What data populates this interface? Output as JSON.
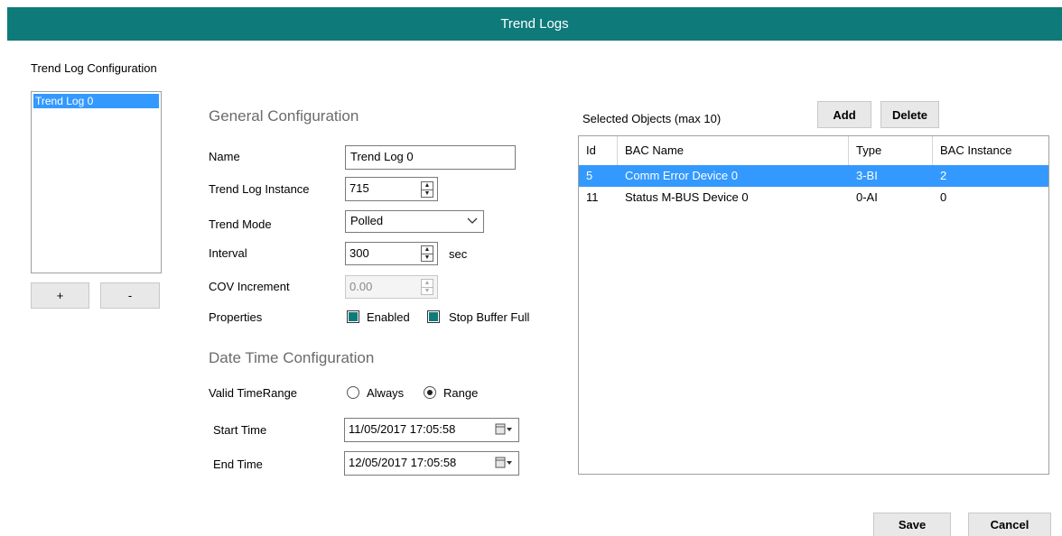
{
  "window": {
    "title": "Trend Logs"
  },
  "trend_log_configuration": {
    "title": "Trend Log Configuration",
    "items": [
      "Trend Log 0"
    ],
    "add_label": "+",
    "remove_label": "-"
  },
  "general": {
    "title": "General Configuration",
    "name_label": "Name",
    "name_value": "Trend Log 0",
    "instance_label": "Trend Log Instance",
    "instance_value": "715",
    "mode_label": "Trend Mode",
    "mode_value": "Polled",
    "interval_label": "Interval",
    "interval_value": "300",
    "interval_unit": "sec",
    "cov_label": "COV Increment",
    "cov_value": "0.00",
    "properties_label": "Properties",
    "enabled_label": "Enabled",
    "enabled_checked": true,
    "stop_buffer_label": "Stop Buffer Full",
    "stop_buffer_checked": true
  },
  "datetime": {
    "title": "Date Time Configuration",
    "valid_label": "Valid TimeRange",
    "always_label": "Always",
    "range_label": "Range",
    "selected": "Range",
    "start_label": "Start Time",
    "start_value": "11/05/2017 17:05:58",
    "end_label": "End Time",
    "end_value": "12/05/2017 17:05:58"
  },
  "selected_objects": {
    "title": "Selected Objects (max 10)",
    "add_label": "Add",
    "delete_label": "Delete",
    "columns": [
      "Id",
      "BAC Name",
      "Type",
      "BAC Instance"
    ],
    "rows": [
      {
        "id": "5",
        "name": "Comm Error Device 0",
        "type": "3-BI",
        "instance": "2",
        "selected": true
      },
      {
        "id": "11",
        "name": "Status M-BUS Device 0",
        "type": "0-AI",
        "instance": "0",
        "selected": false
      }
    ]
  },
  "footer": {
    "save_label": "Save",
    "cancel_label": "Cancel"
  },
  "colors": {
    "accent": "#0f7a7a",
    "selection": "#3399ff"
  }
}
